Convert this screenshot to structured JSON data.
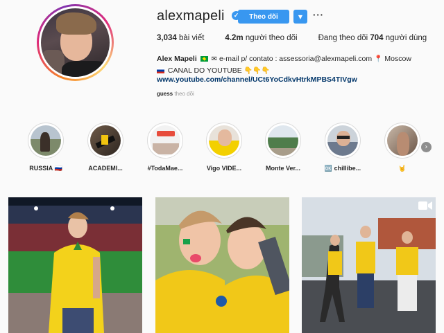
{
  "profile": {
    "username": "alexmapeli",
    "follow_label": "Theo dõi",
    "posts_count": "3,034",
    "posts_label": "bài viết",
    "followers_count": "4.2m",
    "followers_label": "người theo dõi",
    "following_prefix": "Đang theo dõi",
    "following_count": "704",
    "following_suffix": "người dùng",
    "bio_name": "Alex Mapeli",
    "bio_line1_text": "e-mail p/ contato : assessoria@alexmapeli.com",
    "bio_line1_location": "Moscow",
    "bio_line2_text": "CANAL DO YOUTUBE",
    "bio_link": "www.youtube.com/channel/UCt6YoCdkvHtrkMPBS4TIVgw",
    "followed_by_user": "guess",
    "followed_by_label": "theo dõi"
  },
  "icons": {
    "verified": "verified-badge-icon",
    "dropdown": "chevron-down-icon",
    "more": "more-options-icon",
    "next": "chevron-right-icon",
    "video": "video-camera-icon"
  },
  "colors": {
    "accent": "#3897f0",
    "link": "#003569",
    "text": "#262626",
    "muted": "#999999",
    "background": "#fafafa"
  },
  "highlights": [
    {
      "label": "RUSSIA 🇷🇺"
    },
    {
      "label": "ACADEMI..."
    },
    {
      "label": "#TodaMae..."
    },
    {
      "label": "Vigo VIDE..."
    },
    {
      "label": "Monte Ver..."
    },
    {
      "label": "🆗 chillibe..."
    },
    {
      "label": "🤘"
    }
  ]
}
